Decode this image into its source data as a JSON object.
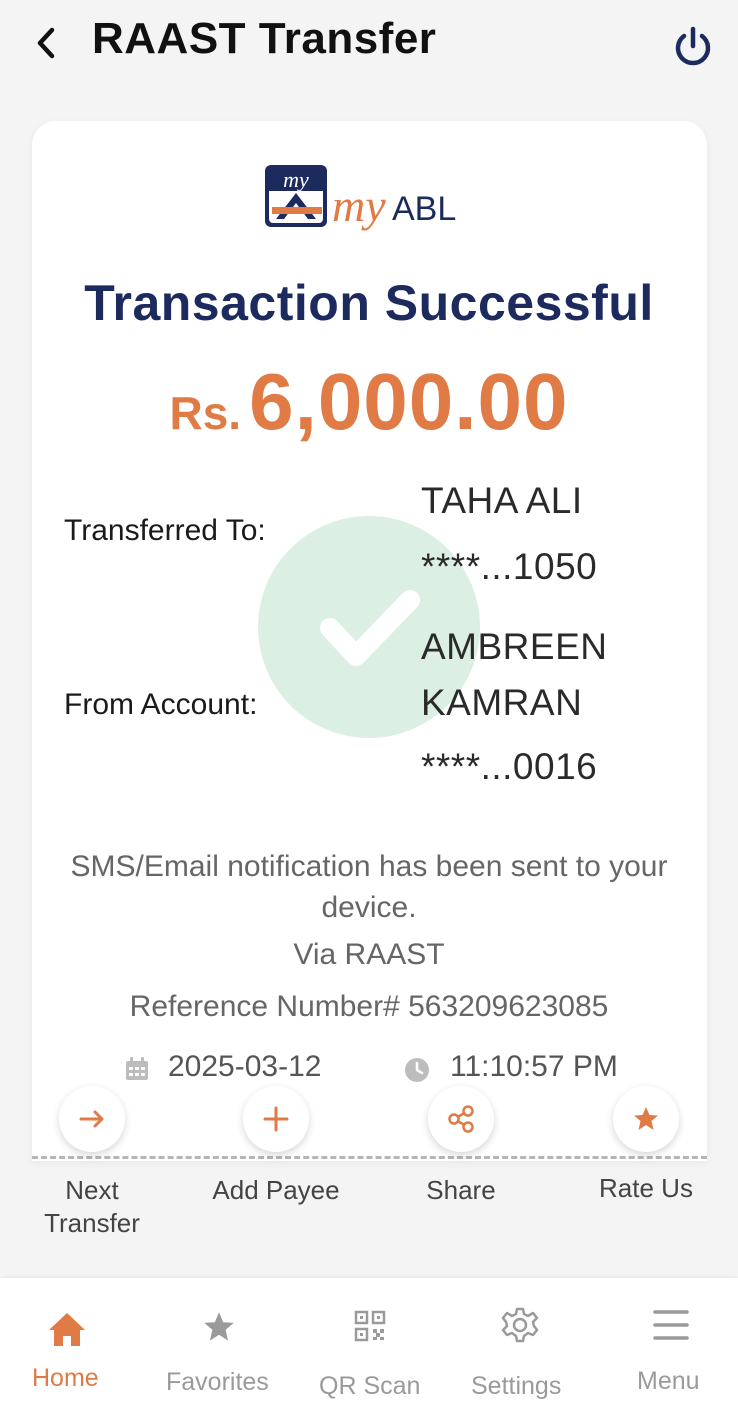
{
  "header": {
    "title": "RAAST Transfer",
    "back_icon": "chevron-left-icon",
    "power_icon": "power-icon"
  },
  "logo": {
    "small_text": "my",
    "brand_prefix": "my",
    "brand_name": "ABL"
  },
  "receipt": {
    "status": "Transaction Successful",
    "currency": "Rs.",
    "amount": "6,000.00",
    "transferred_to_label": "Transferred To:",
    "recipient_name": "TAHA ALI",
    "recipient_account": "****...1050",
    "from_account_label": "From Account:",
    "sender_name_line1": "AMBREEN",
    "sender_name_line2": "KAMRAN",
    "sender_account": "****...0016",
    "notification": "SMS/Email notification has been sent to your device.",
    "channel": "Via RAAST",
    "reference": "Reference Number# 563209623085",
    "date": "2025-03-12",
    "time": "11:10:57 PM"
  },
  "actions": [
    {
      "label_line1": "Next",
      "label_line2": "Transfer",
      "icon": "arrow-right-icon"
    },
    {
      "label_line1": "Add Payee",
      "label_line2": "",
      "icon": "plus-icon"
    },
    {
      "label_line1": "Share",
      "label_line2": "",
      "icon": "share-icon"
    },
    {
      "label_line1": "Rate Us",
      "label_line2": "",
      "icon": "star-icon"
    }
  ],
  "nav": [
    {
      "label": "Home",
      "icon": "home-icon",
      "active": true
    },
    {
      "label": "Favorites",
      "icon": "star-icon",
      "active": false
    },
    {
      "label": "QR Scan",
      "icon": "qr-code-icon",
      "active": false
    },
    {
      "label": "Settings",
      "icon": "gear-icon",
      "active": false
    },
    {
      "label": "Menu",
      "icon": "hamburger-menu-icon",
      "active": false
    }
  ],
  "colors": {
    "accent": "#e07b45",
    "title_navy": "#1d2a5e",
    "success_green": "#dcefe3"
  }
}
